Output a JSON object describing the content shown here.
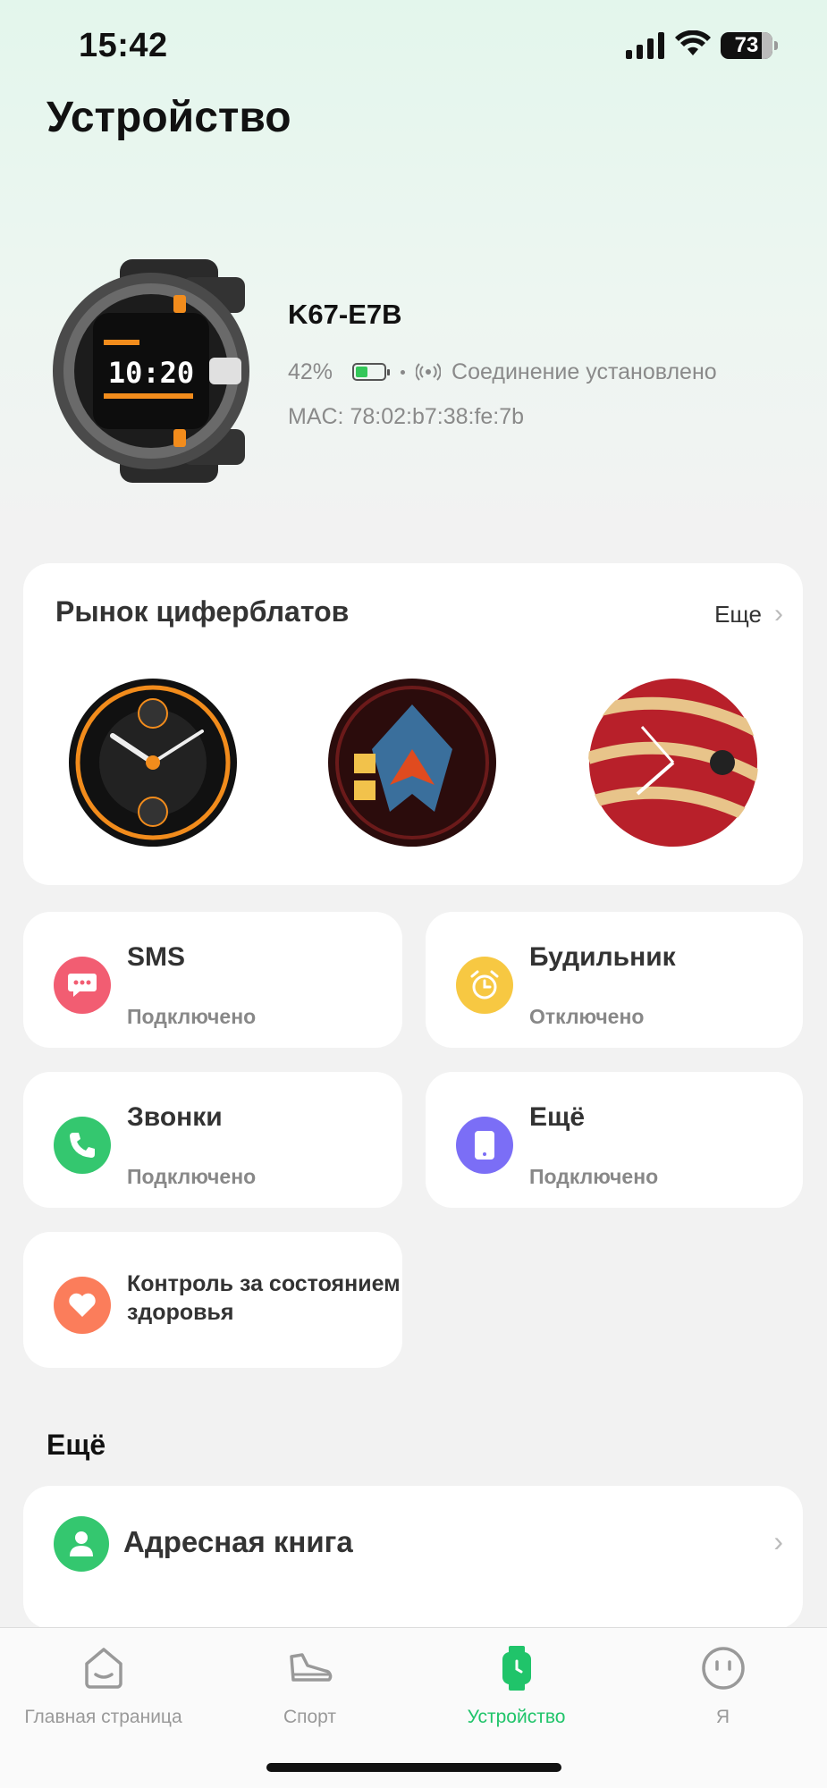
{
  "status_bar": {
    "time": "15:42",
    "battery": "73"
  },
  "page_title": "Устройство",
  "device": {
    "name": "K67-E7B",
    "battery_percent": "42%",
    "battery_level": 0.42,
    "connection_status": "Соединение установлено",
    "mac": "MAC: 78:02:b7:38:fe:7b"
  },
  "watch_faces": {
    "title": "Рынок циферблатов",
    "more_label": "Еще"
  },
  "features": [
    {
      "label": "SMS",
      "status": "Подключено",
      "icon": "message-icon",
      "color": "#f25d72"
    },
    {
      "label": "Будильник",
      "status": "Отключено",
      "icon": "alarm-icon",
      "color": "#f7c842"
    },
    {
      "label": "Звонки",
      "status": "Подключено",
      "icon": "phone-icon",
      "color": "#34c76f"
    },
    {
      "label": "Ещё",
      "status": "Подключено",
      "icon": "device-icon",
      "color": "#7b6ef6"
    },
    {
      "label": "Контроль за состоянием здоровья",
      "icon": "heart-icon",
      "color": "#fb7d5b"
    }
  ],
  "more_section": {
    "title": "Ещё",
    "address_book_label": "Адресная книга"
  },
  "tabs": [
    {
      "label": "Главная страница",
      "icon": "home-icon",
      "active": false
    },
    {
      "label": "Спорт",
      "icon": "sneaker-icon",
      "active": false
    },
    {
      "label": "Устройство",
      "icon": "watch-icon",
      "active": true
    },
    {
      "label": "Я",
      "icon": "face-icon",
      "active": false
    }
  ],
  "colors": {
    "accent": "#20c46a",
    "background": "#f2f2f2"
  }
}
